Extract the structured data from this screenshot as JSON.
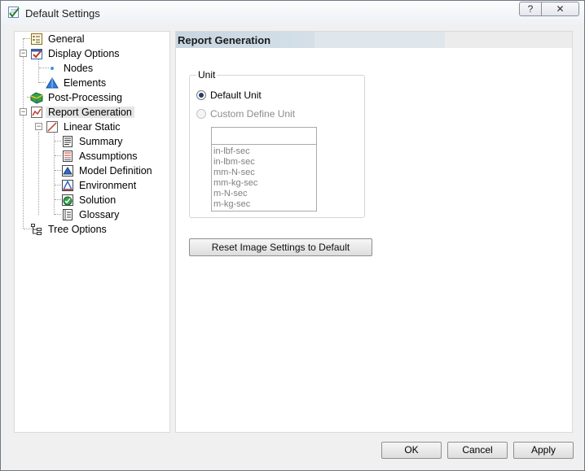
{
  "window": {
    "title": "Default Settings",
    "help_label": "?",
    "close_label": "✕"
  },
  "tree": {
    "items": [
      {
        "label": "General",
        "icon": "general-icon"
      },
      {
        "label": "Display Options",
        "icon": "display-options-icon"
      },
      {
        "label": "Nodes",
        "icon": "nodes-icon"
      },
      {
        "label": "Elements",
        "icon": "elements-icon"
      },
      {
        "label": "Post-Processing",
        "icon": "post-processing-icon"
      },
      {
        "label": "Report Generation",
        "icon": "report-generation-icon",
        "selected": true
      },
      {
        "label": "Linear Static",
        "icon": "linear-static-icon"
      },
      {
        "label": "Summary",
        "icon": "summary-icon"
      },
      {
        "label": "Assumptions",
        "icon": "assumptions-icon"
      },
      {
        "label": "Model Definition",
        "icon": "model-definition-icon"
      },
      {
        "label": "Environment",
        "icon": "environment-icon"
      },
      {
        "label": "Solution",
        "icon": "solution-icon"
      },
      {
        "label": "Glossary",
        "icon": "glossary-icon"
      },
      {
        "label": "Tree Options",
        "icon": "tree-options-icon"
      }
    ],
    "expand_symbol": "−"
  },
  "content": {
    "header": "Report Generation",
    "unit_group": {
      "legend": "Unit",
      "default_unit_label": "Default Unit",
      "custom_unit_label": "Custom Define Unit",
      "input_value": "",
      "unit_options": [
        "in-lbf-sec",
        "in-lbm-sec",
        "mm-N-sec",
        "mm-kg-sec",
        "m-N-sec",
        "m-kg-sec"
      ]
    },
    "reset_label": "Reset Image Settings to Default"
  },
  "footer": {
    "ok_label": "OK",
    "cancel_label": "Cancel",
    "apply_label": "Apply"
  }
}
